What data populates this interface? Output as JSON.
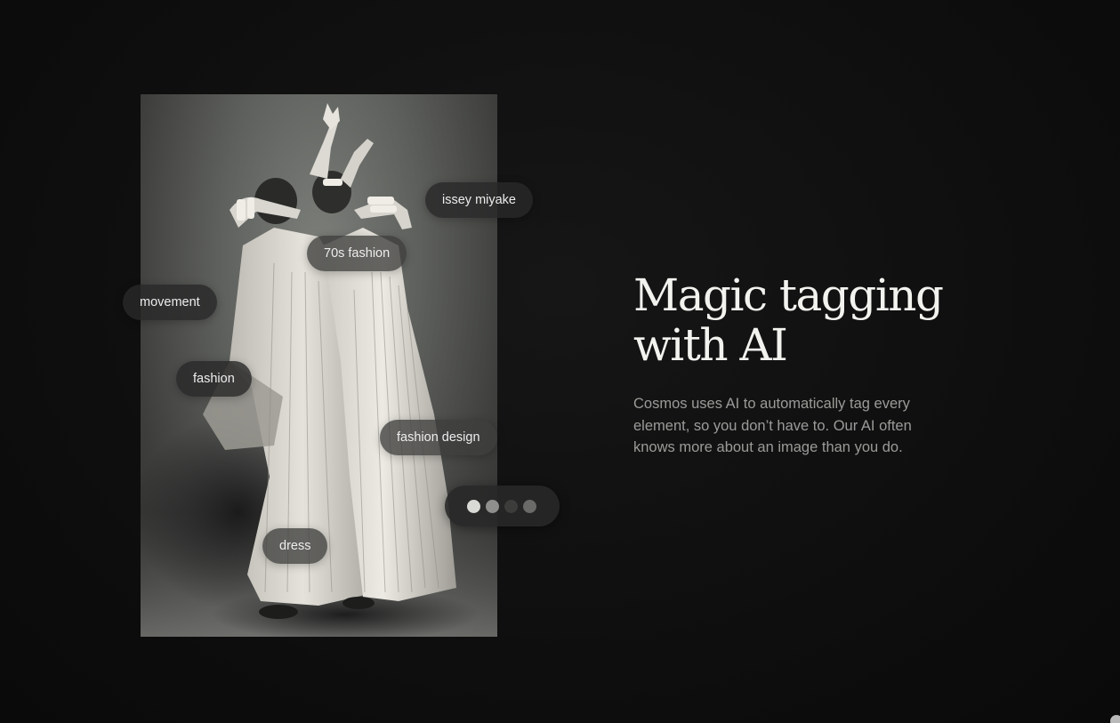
{
  "hero": {
    "headline": "Magic tagging with AI",
    "description": "Cosmos uses AI to automatically tag every element, so you don’t have to. Our AI often knows more about an image than you do."
  },
  "image": {
    "subject": "black-and-white photo of two figures in pleated dresses with raised arms"
  },
  "tags": [
    {
      "label": "issey miyake"
    },
    {
      "label": "70s fashion"
    },
    {
      "label": "movement"
    },
    {
      "label": "fashion"
    },
    {
      "label": "fashion design"
    },
    {
      "label": "dress"
    }
  ],
  "pagination": {
    "dot_colors": [
      "#d9d9d6",
      "#8f8f8d",
      "#3c3c3b",
      "#6a6a69"
    ],
    "active_index": 0
  },
  "theme": {
    "background": "#0f0f0f",
    "tag_background": "#3e3e3c",
    "headline_color": "#f2f2ef",
    "body_color": "#9b9b98"
  }
}
